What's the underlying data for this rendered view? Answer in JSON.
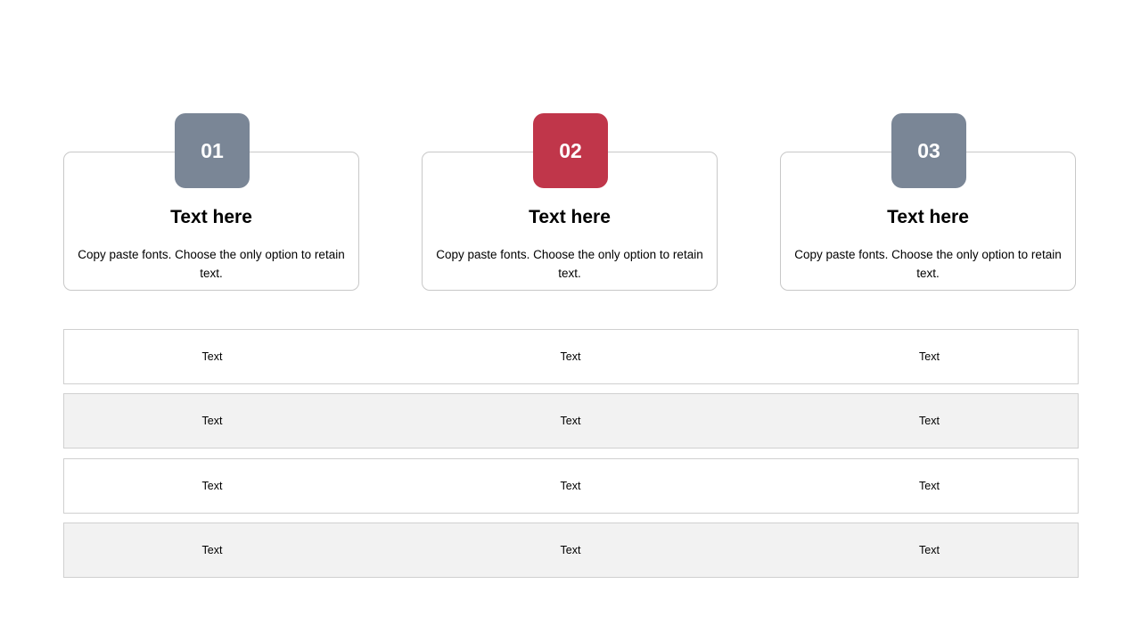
{
  "colors": {
    "badge_default": "#7a8696",
    "badge_accent": "#c0364a",
    "row_alt": "#f2f2f2",
    "border": "#c8c8c8"
  },
  "cards": [
    {
      "number": "01",
      "title": "Text here",
      "description": "Copy paste fonts. Choose the only option to retain text.",
      "color": "#7a8696"
    },
    {
      "number": "02",
      "title": "Text here",
      "description": "Copy paste fonts. Choose the only option to retain text.",
      "color": "#c0364a"
    },
    {
      "number": "03",
      "title": "Text here",
      "description": "Copy paste fonts. Choose the only option to retain text.",
      "color": "#7a8696"
    }
  ],
  "table": {
    "rows": [
      [
        "Text",
        "Text",
        "Text"
      ],
      [
        "Text",
        "Text",
        "Text"
      ],
      [
        "Text",
        "Text",
        "Text"
      ],
      [
        "Text",
        "Text",
        "Text"
      ]
    ]
  }
}
